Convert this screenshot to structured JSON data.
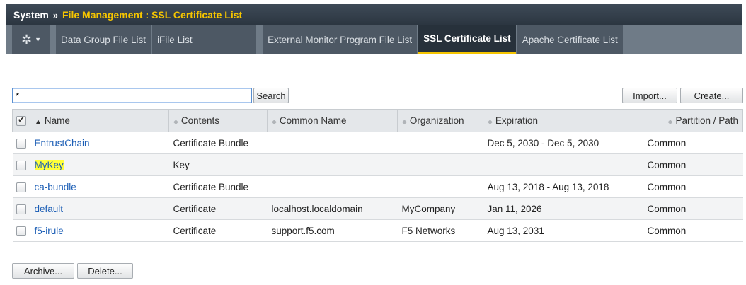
{
  "header": {
    "section": "System",
    "separator": "»",
    "breadcrumb": "File Management : SSL Certificate List"
  },
  "tabs": [
    {
      "label": "Data Group File List"
    },
    {
      "label": "iFile List"
    },
    {
      "label": "External Monitor Program File List"
    },
    {
      "label": "SSL Certificate List",
      "active": true
    },
    {
      "label": "Apache Certificate List"
    }
  ],
  "search": {
    "value": "*",
    "button_label": "Search"
  },
  "actions": {
    "import_label": "Import...",
    "create_label": "Create...",
    "archive_label": "Archive...",
    "delete_label": "Delete..."
  },
  "table": {
    "columns": [
      "Name",
      "Contents",
      "Common Name",
      "Organization",
      "Expiration",
      "Partition / Path"
    ],
    "rows": [
      {
        "name": "EntrustChain",
        "contents": "Certificate Bundle",
        "common_name": "",
        "organization": "",
        "expiration": "Dec 5, 2030 - Dec 5, 2030",
        "partition": "Common"
      },
      {
        "name": "MyKey",
        "contents": "Key",
        "common_name": "",
        "organization": "",
        "expiration": "",
        "partition": "Common"
      },
      {
        "name": "ca-bundle",
        "contents": "Certificate Bundle",
        "common_name": "",
        "organization": "",
        "expiration": "Aug 13, 2018 - Aug 13, 2018",
        "partition": "Common"
      },
      {
        "name": "default",
        "contents": "Certificate",
        "common_name": "localhost.localdomain",
        "organization": "MyCompany",
        "expiration": "Jan 11, 2026",
        "partition": "Common"
      },
      {
        "name": "f5-irule",
        "contents": "Certificate",
        "common_name": "support.f5.com",
        "organization": "F5 Networks",
        "expiration": "Aug 13, 2031",
        "partition": "Common"
      }
    ]
  },
  "colors": {
    "accent": "#f5c500",
    "link": "#1d5fb6",
    "highlight": "#ffff3a"
  }
}
